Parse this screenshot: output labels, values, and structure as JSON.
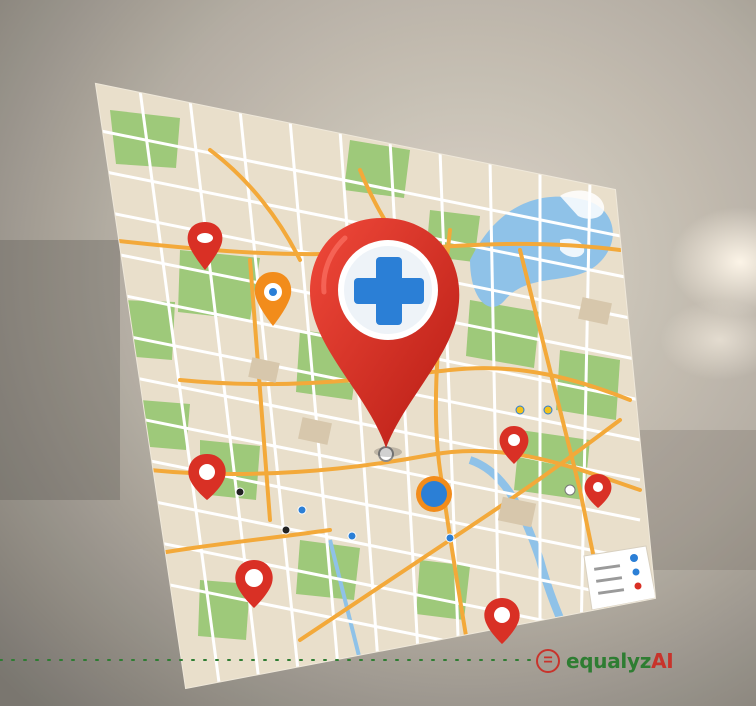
{
  "brand": {
    "mark_symbol": "=",
    "name_prefix": "equalyz",
    "name_suffix": "AI",
    "mark_color": "#c8332b",
    "name_color": "#2e7d32"
  },
  "pins": {
    "main_icon": "medical-cross-icon",
    "main_color": "#d93025",
    "accent_blue": "#2b7fd6",
    "accent_orange": "#f28c1b"
  },
  "colors": {
    "map_land": "#e9dfcb",
    "park": "#9ec97a",
    "water": "#8fc2e8",
    "road": "#f3a93a"
  }
}
